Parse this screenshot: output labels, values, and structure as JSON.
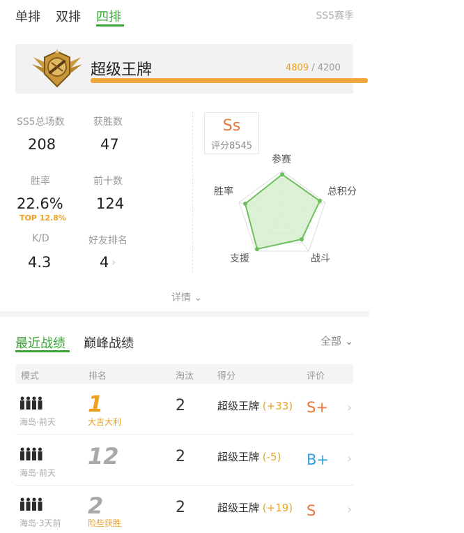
{
  "tabs": {
    "solo": "单排",
    "duo": "双排",
    "squad": "四排",
    "season": "SS5赛季"
  },
  "rank": {
    "name": "超级王牌",
    "current": "4809",
    "separator": "/",
    "max": "4200"
  },
  "stats": [
    {
      "label": "SS5总场数",
      "value": "208"
    },
    {
      "label": "获胜数",
      "value": "47"
    },
    {
      "label": "胜率",
      "value": "22.6%",
      "badge": "TOP 12.8%"
    },
    {
      "label": "前十数",
      "value": "124"
    },
    {
      "label": "K/D",
      "value": "4.3"
    },
    {
      "label": "好友排名",
      "value": "4"
    }
  ],
  "radar": {
    "grade": "Ss",
    "score_text": "评分8545",
    "labels": {
      "top": "参赛",
      "right": "总积分",
      "bottom_right": "战斗",
      "bottom_left": "支援",
      "left": "胜率"
    },
    "colors": {
      "fill": "#d7efd0",
      "stroke": "#6cc05a",
      "grid": "#d8d8d8"
    }
  },
  "detail": "详情",
  "records": {
    "tab_recent": "最近战绩",
    "tab_peak": "巅峰战绩",
    "filter": "全部",
    "headers": [
      "模式",
      "排名",
      "淘汰",
      "得分",
      "评价"
    ],
    "rows": [
      {
        "mode": "海岛·前天",
        "rank": "1",
        "rank_note": "大吉大利",
        "kills": "2",
        "score_name": "超级王牌",
        "score_delta": "(+33)",
        "grade": "S+",
        "rank_color": "#f0a020",
        "grade_color": "#e8783a"
      },
      {
        "mode": "海岛·前天",
        "rank": "12",
        "rank_note": "",
        "kills": "2",
        "score_name": "超级王牌",
        "score_delta": "(-5)",
        "grade": "B+",
        "rank_color": "#a9a9a9",
        "grade_color": "#2f9fe0"
      },
      {
        "mode": "海岛·3天前",
        "rank": "2",
        "rank_note": "险些获胜",
        "kills": "2",
        "score_name": "超级王牌",
        "score_delta": "(+19)",
        "grade": "S",
        "rank_color": "#a9a9a9",
        "grade_color": "#e8783a"
      }
    ]
  },
  "icons": {
    "rank_badge": "rank-emblem-icon",
    "squad": "squad-icon",
    "chevron": "chevron-right-icon",
    "dropdown": "chevron-down-icon"
  },
  "colors": {
    "accent": "#3aa536",
    "gold": "#f0a020"
  }
}
